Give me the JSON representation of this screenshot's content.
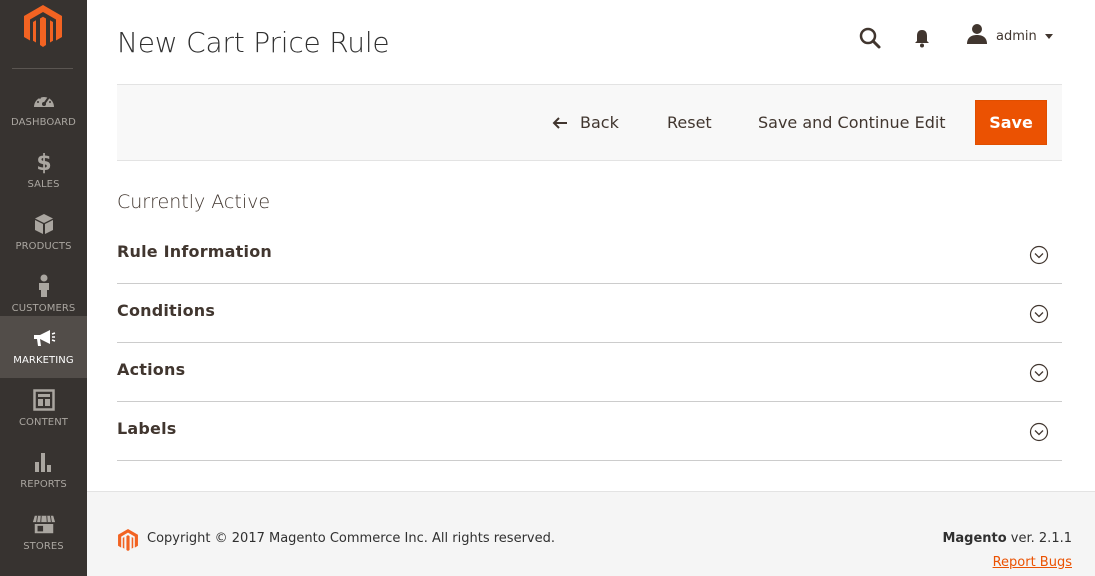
{
  "colors": {
    "sidebar_bg": "#373330",
    "sidebar_active_bg": "#524d49",
    "accent": "#eb5202",
    "logo_orange": "#f26322"
  },
  "sidebar": {
    "logo_icon": "magento-logo-icon",
    "items": [
      {
        "label": "DASHBOARD",
        "icon": "dashboard-gauge-icon",
        "active": false
      },
      {
        "label": "SALES",
        "icon": "dollar-icon",
        "active": false
      },
      {
        "label": "PRODUCTS",
        "icon": "box-icon",
        "active": false
      },
      {
        "label": "CUSTOMERS",
        "icon": "person-icon",
        "active": false
      },
      {
        "label": "MARKETING",
        "icon": "megaphone-icon",
        "active": true
      },
      {
        "label": "CONTENT",
        "icon": "layout-icon",
        "active": false
      },
      {
        "label": "REPORTS",
        "icon": "bar-chart-icon",
        "active": false
      },
      {
        "label": "STORES",
        "icon": "store-icon",
        "active": false
      }
    ]
  },
  "header": {
    "title": "New Cart Price Rule",
    "user": "admin"
  },
  "actions": {
    "back": "Back",
    "reset": "Reset",
    "save_continue": "Save and Continue Edit",
    "save": "Save"
  },
  "content": {
    "status": "Currently Active",
    "sections": [
      {
        "title": "Rule Information"
      },
      {
        "title": "Conditions"
      },
      {
        "title": "Actions"
      },
      {
        "title": "Labels"
      }
    ]
  },
  "footer": {
    "copyright": "Copyright © 2017 Magento Commerce Inc. All rights reserved.",
    "brand": "Magento",
    "version": " ver. 2.1.1",
    "report_bugs": "Report Bugs"
  }
}
